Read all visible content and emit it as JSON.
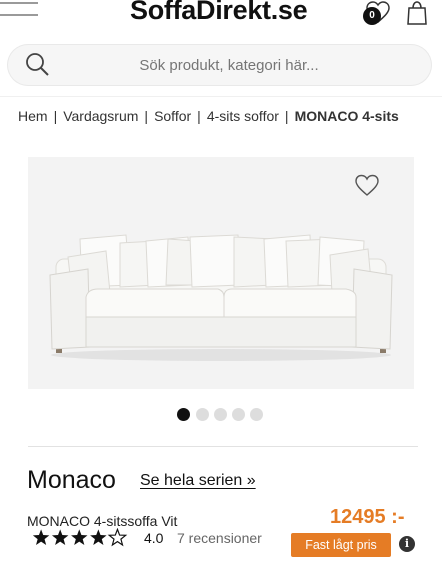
{
  "header": {
    "logo_text": "SoffaDirekt.se",
    "wishlist_count": "0",
    "icons": [
      "menu-icon",
      "heart-icon",
      "shopping-bag-icon"
    ]
  },
  "search": {
    "placeholder": "Sök produkt, kategori här..."
  },
  "breadcrumb": {
    "items": [
      "Hem",
      "Vardagsrum",
      "Soffor",
      "4-sits soffor"
    ],
    "current": "MONACO 4-sits"
  },
  "gallery": {
    "image_count": 5,
    "active_index": 0
  },
  "product": {
    "title": "Monaco",
    "series_link": "Se hela serien »",
    "subtitle": "MONACO 4-sitssoffa Vit",
    "rating": "4.0",
    "stars_filled": 4,
    "stars_total": 5,
    "reviews": "7 recensioner",
    "price": "12495 :-",
    "price_badge": "Fast lågt pris",
    "info_icon": "i"
  },
  "colors": {
    "accent": "#e57c25",
    "text": "#111111"
  }
}
